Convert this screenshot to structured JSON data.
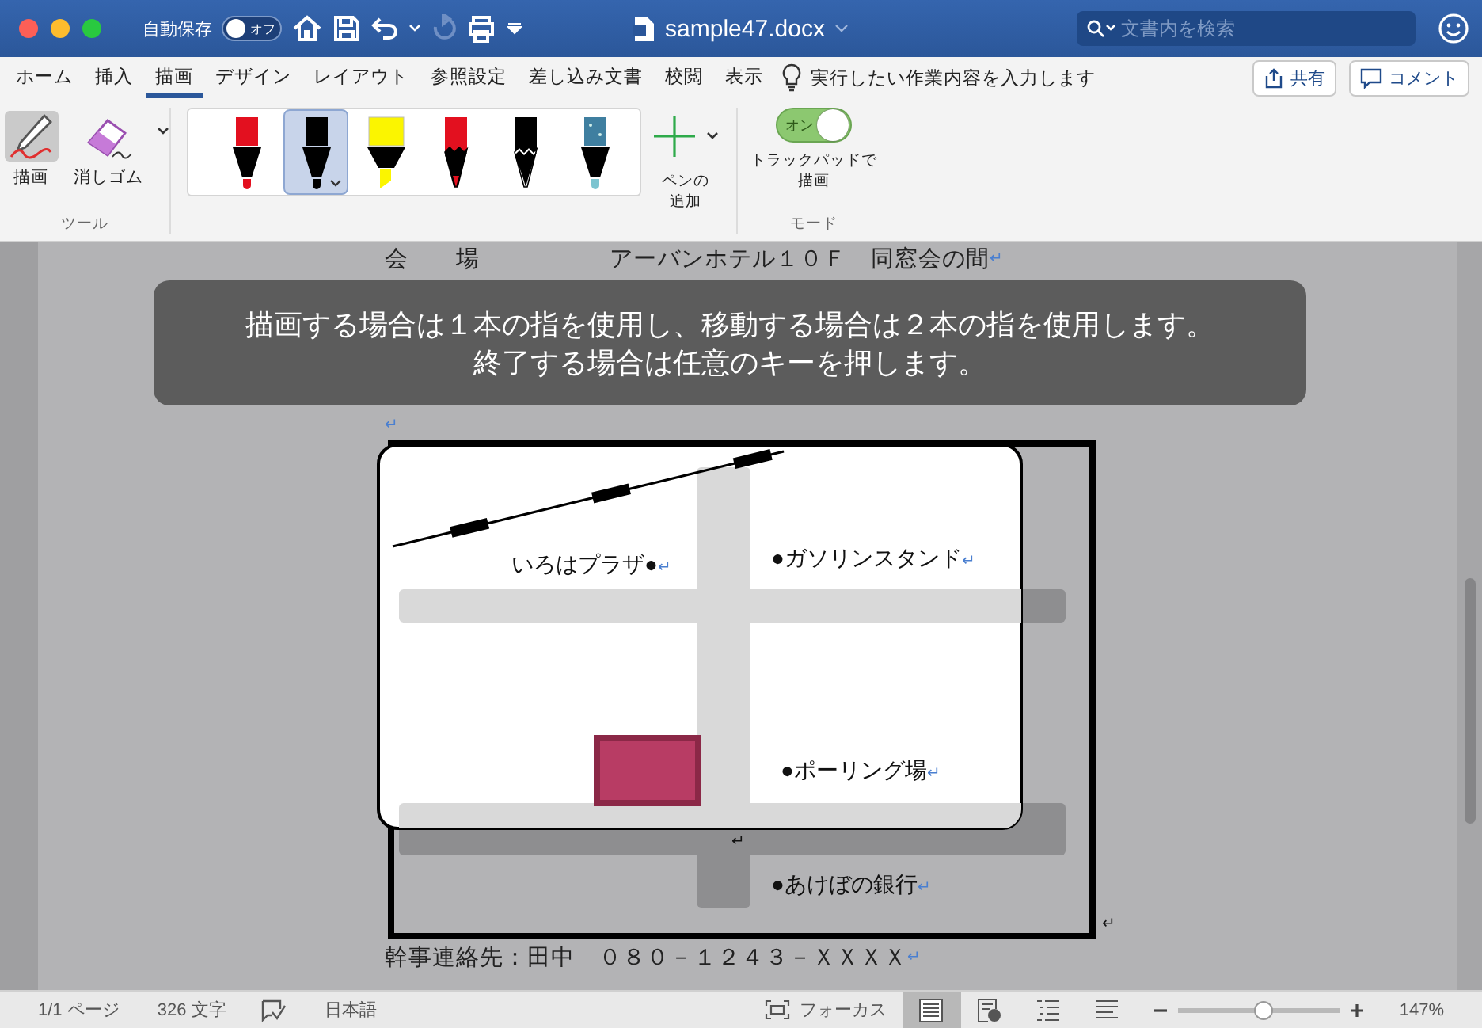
{
  "window": {
    "title": "sample47.docx",
    "autosave": {
      "label": "自動保存",
      "state_text": "オフ",
      "on": false
    },
    "search": {
      "placeholder": "文書内を検索"
    }
  },
  "tabs": [
    {
      "label": "ホーム",
      "selected": false
    },
    {
      "label": "挿入",
      "selected": false
    },
    {
      "label": "描画",
      "selected": true
    },
    {
      "label": "デザイン",
      "selected": false
    },
    {
      "label": "レイアウト",
      "selected": false
    },
    {
      "label": "参照設定",
      "selected": false
    },
    {
      "label": "差し込み文書",
      "selected": false
    },
    {
      "label": "校閲",
      "selected": false
    },
    {
      "label": "表示",
      "selected": false
    }
  ],
  "tell_me": "実行したい作業内容を入力します",
  "share_button": "共有",
  "comment_button": "コメント",
  "ribbon": {
    "tools": {
      "group_label": "ツール",
      "items": [
        {
          "kind": "draw",
          "label": "描画",
          "selected": true
        },
        {
          "kind": "eraser",
          "label": "消しゴム",
          "selected": false
        }
      ]
    },
    "pens": {
      "items": [
        {
          "kind": "pen",
          "color": "#e3101f",
          "selected": false
        },
        {
          "kind": "pen",
          "color": "#000000",
          "selected": true
        },
        {
          "kind": "highlighter",
          "color": "#fbf500",
          "selected": false
        },
        {
          "kind": "pencil",
          "color": "#e3101f",
          "selected": false
        },
        {
          "kind": "pencil",
          "color": "#000000",
          "selected": false
        },
        {
          "kind": "galaxy",
          "color": "#3f7fa0",
          "selected": false
        }
      ],
      "add_label": "ペンの追加"
    },
    "mode": {
      "toggle": {
        "text": "オン",
        "on": true
      },
      "label": "トラックパッドで描画",
      "group_label": "モード"
    }
  },
  "document": {
    "venue": {
      "label": "会　　場",
      "value": "アーバンホテル１０Ｆ　同窓会の間",
      "mark": "↵"
    },
    "empty_mark": "↵",
    "map": {
      "labels": [
        {
          "text": "いろはプラザ●",
          "mark": "↵"
        },
        {
          "text": "●ガソリンスタンド",
          "mark": "↵"
        },
        {
          "text": "●ポーリング場",
          "mark": "↵"
        },
        {
          "text": "●あけぼの銀行",
          "mark": "↵"
        }
      ],
      "marks": [
        "↵",
        "↵"
      ]
    },
    "contact": {
      "text": "幹事連絡先：田中　０８０－１２４３－ＸＸＸＸ",
      "mark": "↵"
    }
  },
  "overlay": {
    "lines": [
      "描画する場合は１本の指を使用し、移動する場合は２本の指を使用します。",
      "終了する場合は任意のキーを押します。"
    ]
  },
  "status_bar": {
    "page": "1/1 ページ",
    "words": "326 文字",
    "language": "日本語",
    "focus": "フォーカス",
    "views": [
      {
        "kind": "print",
        "selected": true
      },
      {
        "kind": "web",
        "selected": false
      },
      {
        "kind": "outline",
        "selected": false
      },
      {
        "kind": "draft",
        "selected": false
      }
    ],
    "zoom": {
      "level": 0.53,
      "value": "147%"
    }
  }
}
